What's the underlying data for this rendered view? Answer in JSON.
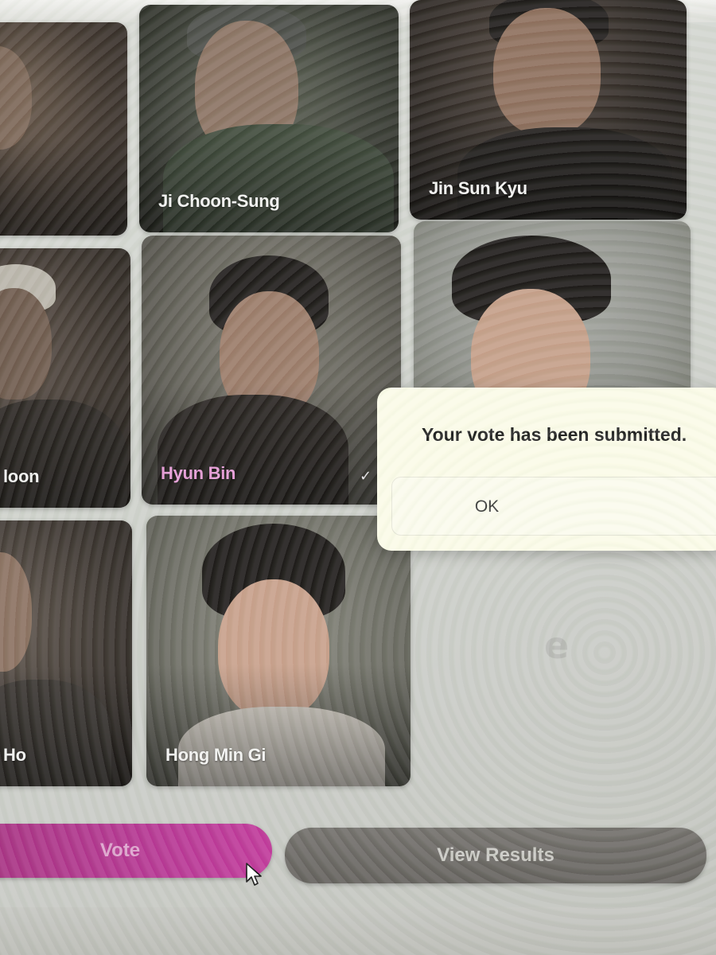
{
  "candidates": [
    {
      "name": "",
      "selected": false
    },
    {
      "name": "Ji Choon-Sung",
      "selected": false
    },
    {
      "name": "Jin Sun Kyu",
      "selected": false
    },
    {
      "name": "loon",
      "selected": false
    },
    {
      "name": "Hyun Bin",
      "selected": true
    },
    {
      "name": "",
      "selected": false
    },
    {
      "name": "Ho",
      "selected": false
    },
    {
      "name": "Hong Min Gi",
      "selected": false
    }
  ],
  "dialog": {
    "message": "Your vote has been submitted.",
    "ok_label": "OK"
  },
  "watermark": "e",
  "actions": {
    "vote_label": "Vote",
    "results_label": "View Results"
  },
  "colors": {
    "accent": "#b53592",
    "selected_name": "#e59bd6",
    "dialog_bg": "#fbfbe8"
  },
  "icons": [
    "checkmark-icon",
    "mouse-cursor-icon"
  ]
}
